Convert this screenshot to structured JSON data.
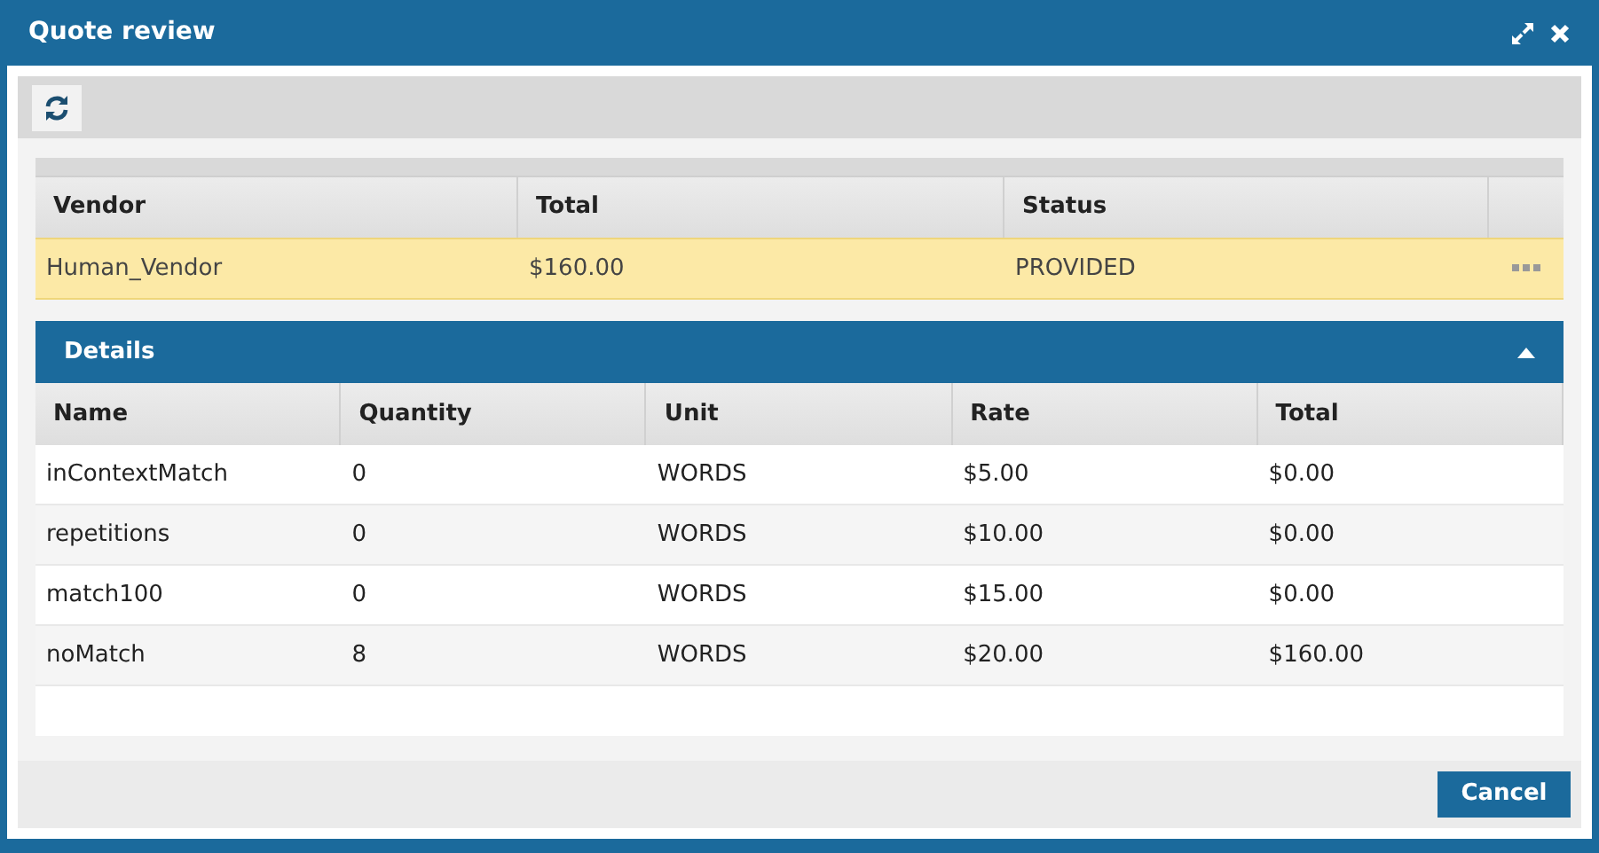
{
  "window": {
    "title": "Quote review"
  },
  "vendors": {
    "columns": [
      "Vendor",
      "Total",
      "Status"
    ],
    "rows": [
      {
        "cells": [
          "Human_Vendor",
          "$160.00",
          "PROVIDED"
        ],
        "selected": true
      }
    ]
  },
  "details": {
    "title": "Details",
    "expanded": true,
    "columns": [
      "Name",
      "Quantity",
      "Unit",
      "Rate",
      "Total"
    ],
    "rows": [
      [
        "inContextMatch",
        "0",
        "WORDS",
        "$5.00",
        "$0.00"
      ],
      [
        "repetitions",
        "0",
        "WORDS",
        "$10.00",
        "$0.00"
      ],
      [
        "match100",
        "0",
        "WORDS",
        "$15.00",
        "$0.00"
      ],
      [
        "noMatch",
        "8",
        "WORDS",
        "$20.00",
        "$160.00"
      ]
    ]
  },
  "buttons": [
    "Cancel"
  ]
}
